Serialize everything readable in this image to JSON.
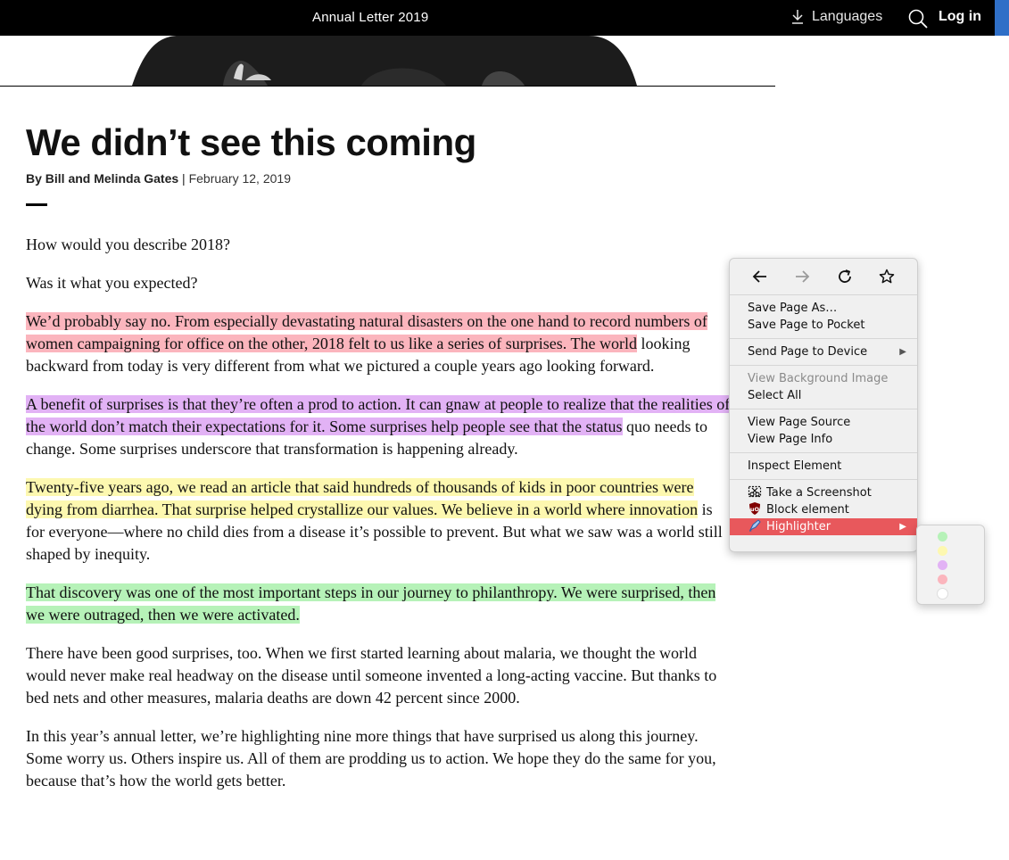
{
  "topbar": {
    "title": "Annual Letter 2019",
    "languages_label": "Languages",
    "login_label": "Log in"
  },
  "article": {
    "headline": "We didn’t see this coming",
    "byline_authors": "By Bill and Melinda Gates",
    "byline_separator": " | ",
    "byline_date": "February 12, 2019",
    "paragraphs": [
      "How would you describe 2018?",
      "Was it what you expected?",
      "We’d probably say no. From especially devastating natural disasters on the one hand to record numbers of women campaigning for office on the other, 2018 felt to us like a series of surprises. The world",
      "looking backward from today is very different from what we pictured a couple years ago looking forward.",
      "A benefit of surprises is that they’re often a prod to action. It can gnaw at people to realize that the realities of the world don’t match their expectations for it. Some surprises help people see that the status",
      "quo needs to change. Some surprises underscore that transformation is happening already.",
      "Twenty-five years ago, we read an article that said hundreds of thousands of kids in poor countries were dying from diarrhea. That surprise helped crystallize our values. We believe in a world where innovation",
      "is for everyone—where no child dies from a disease it’s possible to prevent. But what we saw was a world still shaped by inequity.",
      "That discovery was one of the most important steps in our journey to philanthropy. We were surprised, then we were outraged, then we were activated.",
      "There have been good surprises, too. When we first started learning about malaria, we thought the world would never make real headway on the disease until someone invented a long-acting vaccine. But thanks to bed nets and other measures, malaria deaths are down 42 percent since 2000.",
      "In this year’s annual letter, we’re highlighting nine more things that have surprised us along this journey. Some worry us. Others inspire us. All of them are prodding us to action. We hope they do the same for you, because that’s how the world gets better."
    ]
  },
  "context_menu": {
    "items": {
      "save_page_as": "Save Page As…",
      "save_to_pocket": "Save Page to Pocket",
      "send_to_device": "Send Page to Device",
      "view_bg_image": "View Background Image",
      "select_all": "Select All",
      "view_source": "View Page Source",
      "view_info": "View Page Info",
      "inspect": "Inspect Element",
      "screenshot": "Take a Screenshot",
      "block_element": "Block element",
      "highlighter": "Highlighter"
    },
    "submenu_arrow": "▶"
  },
  "highlighter_colors": [
    "#b6f2b8",
    "#fdf8b0",
    "#e2b2f5",
    "#fbb5bd",
    "#ffffff"
  ],
  "colors": {
    "topbar_bg": "#000000",
    "accent_blue": "#2f6fc7",
    "menu_active": "#e8585c"
  }
}
